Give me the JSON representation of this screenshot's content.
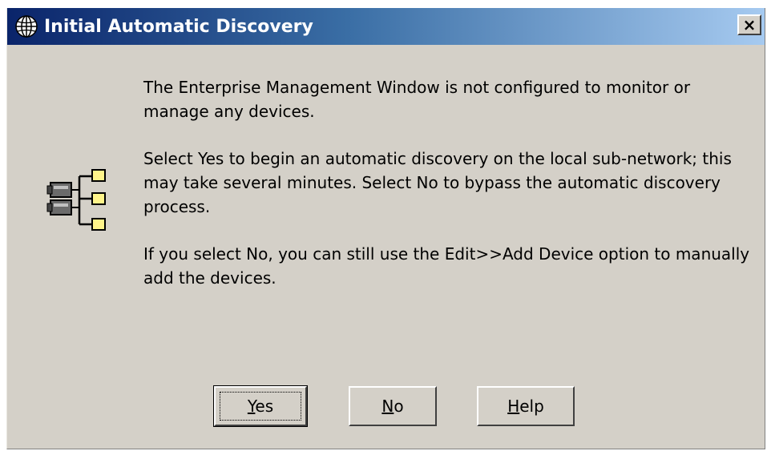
{
  "dialog": {
    "title": "Initial Automatic Discovery",
    "close_label": "×",
    "title_icon": "globe-icon",
    "content_icon": "network-devices-icon"
  },
  "message": {
    "paragraph1": "The Enterprise Management Window is not configured to monitor or manage any devices.",
    "paragraph2": "Select Yes to begin an automatic discovery on the local sub-network; this may take several minutes. Select No to bypass the automatic discovery process.",
    "paragraph3": "If you select No, you can still use the Edit>>Add Device option to manually add the devices."
  },
  "buttons": {
    "yes": {
      "mnemonic": "Y",
      "rest": "es"
    },
    "no": {
      "mnemonic": "N",
      "rest": "o"
    },
    "help": {
      "mnemonic": "H",
      "rest": "elp"
    }
  },
  "colors": {
    "titlebar_start": "#0a246a",
    "titlebar_end": "#a6caf0",
    "dialog_bg": "#d4d0c8"
  }
}
